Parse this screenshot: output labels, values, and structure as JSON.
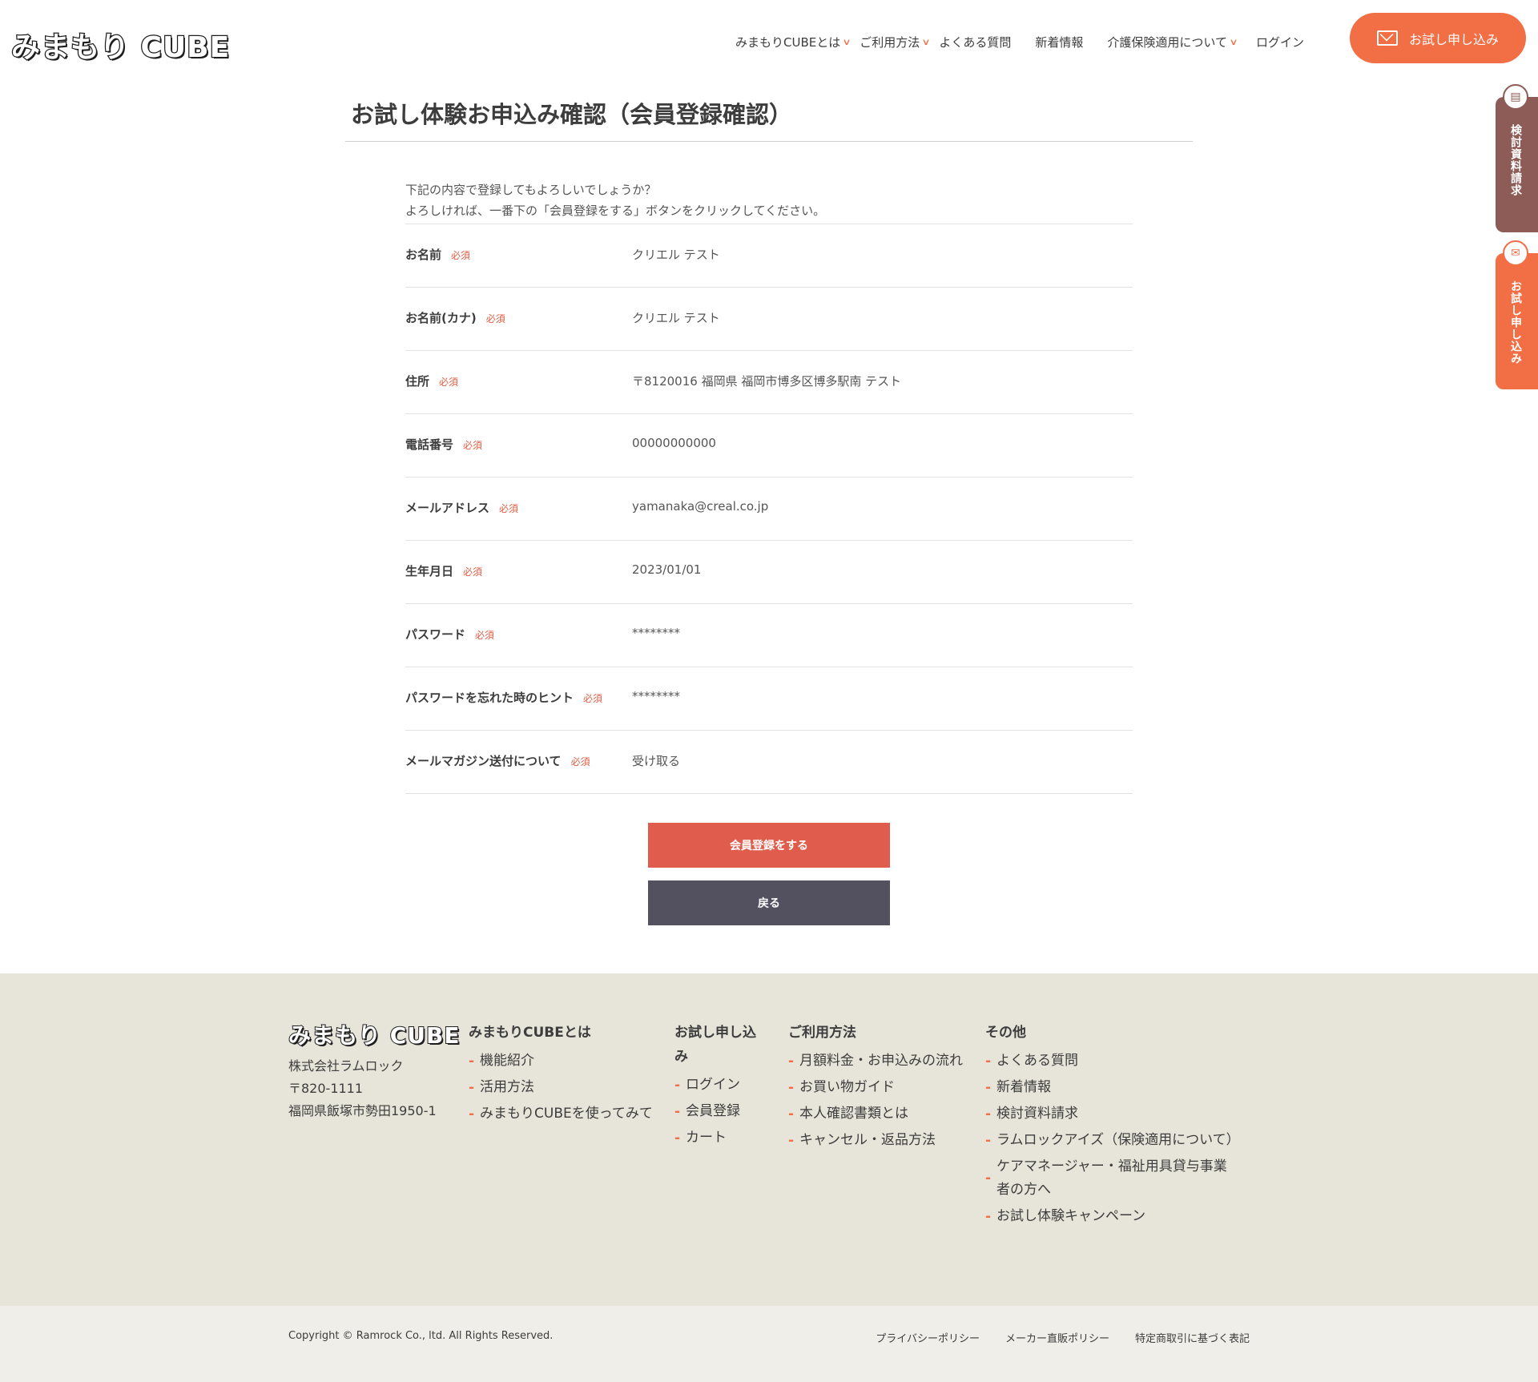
{
  "header": {
    "logo": "みまもり CUBE",
    "nav": [
      {
        "label": "みまもりCUBEとは",
        "dropdown": true
      },
      {
        "label": "ご利用方法",
        "dropdown": true
      },
      {
        "label": "よくある質問",
        "dropdown": false
      },
      {
        "label": "新着情報",
        "dropdown": false
      },
      {
        "label": "介護保険適用について",
        "dropdown": true
      },
      {
        "label": "ログイン",
        "dropdown": false
      }
    ],
    "cta_label": "お試し申し込み"
  },
  "side_tabs": {
    "documents": "検討資料請求",
    "trial": "お試し申し込み"
  },
  "main": {
    "title": "お試し体験お申込み確認（会員登録確認）",
    "intro_line1": "下記の内容で登録してもよろしいでしょうか？",
    "intro_line2": "よろしければ、一番下の「会員登録をする」ボタンをクリックしてください。",
    "required_label": "必須",
    "rows": [
      {
        "label": "お名前",
        "value": "クリエル テスト"
      },
      {
        "label": "お名前(カナ)",
        "value": "クリエル テスト"
      },
      {
        "label": "住所",
        "value": "〒8120016 福岡県 福岡市博多区博多駅南 テスト"
      },
      {
        "label": "電話番号",
        "value": "00000000000"
      },
      {
        "label": "メールアドレス",
        "value": "yamanaka@creal.co.jp"
      },
      {
        "label": "生年月日",
        "value": "2023/01/01"
      },
      {
        "label": "パスワード",
        "value": "********"
      },
      {
        "label": "パスワードを忘れた時のヒント",
        "value": "********"
      },
      {
        "label": "メールマガジン送付について",
        "value": "受け取る"
      }
    ],
    "submit_label": "会員登録をする",
    "back_label": "戻る"
  },
  "footer": {
    "logo": "みまもり CUBE",
    "company": "株式会社ラムロック",
    "postal": "〒820-1111",
    "address": "福岡県飯塚市勢田1950-1",
    "columns": [
      {
        "title": "みまもりCUBEとは",
        "items": [
          "機能紹介",
          "活用方法",
          "みまもりCUBEを使ってみて"
        ]
      },
      {
        "title": "お試し申し込み",
        "items": [
          "ログイン",
          "会員登録",
          "カート"
        ]
      },
      {
        "title": "ご利用方法",
        "items": [
          "月額料金・お申込みの流れ",
          "お買い物ガイド",
          "本人確認書類とは",
          "キャンセル・返品方法"
        ]
      },
      {
        "title": "その他",
        "items": [
          "よくある質問",
          "新着情報",
          "検討資料請求",
          "ラムロックアイズ（保険適用について）",
          "ケアマネージャー・福祉用具貸与事業者の方へ",
          "お試し体験キャンペーン"
        ]
      }
    ],
    "copyright": "Copyright © Ramrock Co., ltd. All Rights Reserved.",
    "bottom_links": [
      "プライバシーポリシー",
      "メーカー直販ポリシー",
      "特定商取引に基づく表記"
    ]
  },
  "colors": {
    "accent": "#f26f45",
    "submit": "#e05d4d",
    "back": "#535160",
    "doc_tab": "#8d5c56",
    "footer_bg": "#e7e4d9"
  }
}
